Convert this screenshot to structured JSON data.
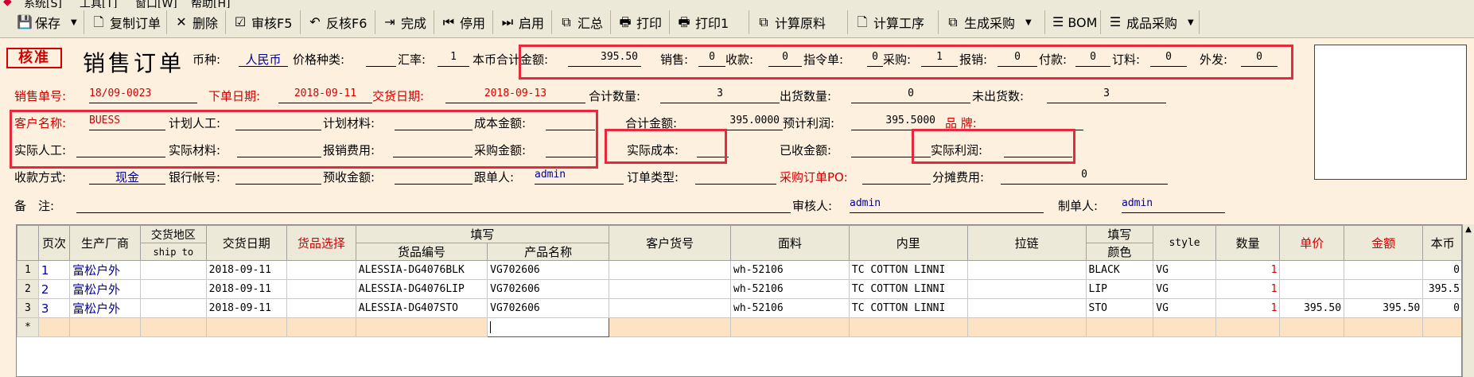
{
  "menu": [
    "系统[S]",
    "工具[T]",
    "窗口[W]",
    "帮助[H]"
  ],
  "toolbar": [
    {
      "id": "save",
      "label": "保存",
      "icon": "💾",
      "caret": true
    },
    {
      "id": "copy",
      "label": "复制订单",
      "icon": "🗋"
    },
    {
      "id": "delete",
      "label": "删除",
      "icon": "✕"
    },
    {
      "id": "review",
      "label": "审核F5",
      "icon": "☑"
    },
    {
      "id": "unreview",
      "label": "反核F6",
      "icon": "↶"
    },
    {
      "id": "complete",
      "label": "完成",
      "icon": "⇥"
    },
    {
      "id": "disable",
      "label": "停用",
      "icon": "⏮"
    },
    {
      "id": "enable",
      "label": "启用",
      "icon": "⏭"
    },
    {
      "id": "summary",
      "label": "汇总",
      "icon": "⧉"
    },
    {
      "id": "print",
      "label": "打印",
      "icon": "🖶"
    },
    {
      "id": "print1",
      "label": "打印1",
      "icon": "🖶"
    },
    {
      "id": "calc_material",
      "label": "计算原料",
      "icon": "⧉"
    },
    {
      "id": "calc_process",
      "label": "计算工序",
      "icon": "🗋"
    },
    {
      "id": "gen_purchase",
      "label": "生成采购",
      "icon": "⧉",
      "caret": true
    },
    {
      "id": "bom",
      "label": "BOM",
      "icon": "☰"
    },
    {
      "id": "product_purchase",
      "label": "成品采购",
      "icon": "☰",
      "caret": true
    }
  ],
  "header": {
    "stamp": "核准",
    "title": "销售订单",
    "currency_label": "币种:",
    "currency": "人民币",
    "price_type_label": "价格种类:",
    "price_type": "",
    "rate_label": "汇率:",
    "rate": "1",
    "total_amount_label": "本币合计金额:",
    "total_amount": "395.50",
    "sales_label": "销售:",
    "sales": "0",
    "receipt_label": "收款:",
    "receipt": "0",
    "instruction_label": "指令单:",
    "instruction": "0",
    "purchase_label": "采购:",
    "purchase": "1",
    "reimburse_label": "报销:",
    "reimburse": "0",
    "payment_label": "付款:",
    "payment": "0",
    "order_label": "订料:",
    "order": "0",
    "outsource_label": "外发:",
    "outsource": "0"
  },
  "row2": {
    "order_no_label": "销售单号:",
    "order_no": "18/09-0023",
    "order_date_label": "下单日期:",
    "order_date": "2018-09-11",
    "delivery_date_label": "交货日期:",
    "delivery_date": "2018-09-13",
    "total_qty_label": "合计数量:",
    "total_qty": "3",
    "shipped_qty_label": "出货数量:",
    "shipped_qty": "0",
    "unshipped_qty_label": "未出货数:",
    "unshipped_qty": "3"
  },
  "row3": {
    "customer_label": "客户名称:",
    "customer": "BUESS",
    "plan_labor_label": "计划人工:",
    "plan_labor": "",
    "plan_material_label": "计划材料:",
    "plan_material": "",
    "cost_amount_label": "成本金额:",
    "cost_amount": "",
    "total_money_label": "合计金额:",
    "total_money": "395.0000",
    "expected_profit_label": "预计利润:",
    "expected_profit": "395.5000",
    "brand_label": "品 牌:",
    "brand": ""
  },
  "row4": {
    "actual_labor_label": "实际人工:",
    "actual_labor": "",
    "actual_material_label": "实际材料:",
    "actual_material": "",
    "expense_label": "报销费用:",
    "expense": "",
    "purchase_amount_label": "采购金额:",
    "purchase_amount": "",
    "actual_cost_label": "实际成本:",
    "actual_cost": "",
    "received_label": "已收金额:",
    "received": "",
    "actual_profit_label": "实际利润:",
    "actual_profit": ""
  },
  "row5": {
    "pay_method_label": "收款方式:",
    "pay_method": "现金",
    "bank_label": "银行帐号:",
    "bank": "",
    "prepay_label": "预收金额:",
    "prepay": "",
    "follower_label": "跟单人:",
    "follower": "admin",
    "order_type_label": "订单类型:",
    "order_type": "",
    "po_label": "采购订单PO:",
    "po": "",
    "share_fee_label": "分摊费用:",
    "share_fee": "0"
  },
  "row6": {
    "remark_label": "备　注:",
    "remark": "",
    "reviewer_label": "审核人:",
    "reviewer": "admin",
    "creator_label": "制单人:",
    "creator": "admin"
  },
  "grid": {
    "headers": {
      "page": "页次",
      "maker": "生产厂商",
      "area": "交货地区",
      "area_sub": "ship to",
      "delivery": "交货日期",
      "select": "货品选择",
      "fill": "填写",
      "code": "货品编号",
      "name": "产品名称",
      "cust_code": "客户货号",
      "fabric": "面料",
      "lining": "内里",
      "zipper": "拉链",
      "color_fill": "填写",
      "color": "颜色",
      "style": "style",
      "qty": "数量",
      "price": "单价",
      "amount": "金额",
      "local": "本币"
    },
    "rows": [
      {
        "rn": "1",
        "page": "1",
        "maker": "富松户外",
        "area": "",
        "delivery": "2018-09-11",
        "select": "",
        "code": "ALESSIA-DG4076BLK",
        "name": "VG702606",
        "cust_code": "",
        "fabric": "wh-52106",
        "lining": "TC COTTON LINNI",
        "zipper": "",
        "color": "BLACK",
        "style": "VG",
        "qty": "1",
        "price": "",
        "amount": "",
        "local": "0"
      },
      {
        "rn": "2",
        "page": "2",
        "maker": "富松户外",
        "area": "",
        "delivery": "2018-09-11",
        "select": "",
        "code": "ALESSIA-DG4076LIP",
        "name": "VG702606",
        "cust_code": "",
        "fabric": "wh-52106",
        "lining": "TC COTTON LINNI",
        "zipper": "",
        "color": "LIP",
        "style": "VG",
        "qty": "1",
        "price": "",
        "amount": "",
        "local": "395.5"
      },
      {
        "rn": "3",
        "page": "3",
        "maker": "富松户外",
        "area": "",
        "delivery": "2018-09-11",
        "select": "",
        "code": "ALESSIA-DG407STO",
        "name": "VG702606",
        "cust_code": "",
        "fabric": "wh-52106",
        "lining": "TC COTTON LINNI",
        "zipper": "",
        "color": "STO",
        "style": "VG",
        "qty": "1",
        "price": "395.50",
        "amount": "395.50",
        "local": "0"
      }
    ],
    "new_row_marker": "*"
  }
}
